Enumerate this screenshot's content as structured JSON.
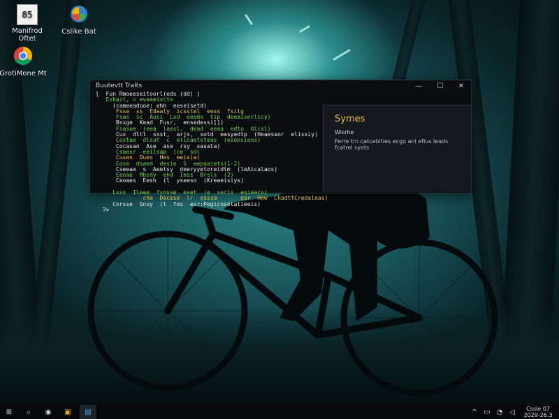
{
  "desktop": {
    "icons": [
      {
        "label": "Manifrod Oftet",
        "badge": "85"
      },
      {
        "label": "Cslike Bat"
      },
      {
        "label": "GrotiMone Mt"
      }
    ]
  },
  "terminal": {
    "title": "Buutevtt Tralts",
    "controls": {
      "minimize": "—",
      "maximize": "☐",
      "close": "✕"
    },
    "code_lines": [
      {
        "text": "ɭ  Fun Rmoeeseitoorl(eds (dd) )",
        "color": "#e8e8e8"
      },
      {
        "text": "   Ezkazt, = evaaeivcts",
        "color": "#6fd44a"
      },
      {
        "text": "     (cameeadooe; ehh  eeseisetd)",
        "color": "#e8e8e8"
      },
      {
        "text": "      Fsse  ss  Edaaly  icsstel  eess  fsilg",
        "color": "#e8c04a"
      },
      {
        "text": "      Fsas  sc  Ausi  Lxd  eeeds  tip  deeaiseclicy)",
        "color": "#6fd44a"
      },
      {
        "text": "      Bsxge  Kead  Fusr,  ensedessi[])",
        "color": "#e8e8e8"
      },
      {
        "text": "      Fsasue  (eea  laesl,  dead  eeaa  edto  dicsl)",
        "color": "#6fd44a"
      },
      {
        "text": "      Cus  dltl  ssst,  arjs,  sotd  easyedtp  (Heaesaor  elissiy)",
        "color": "#e8e8e8"
      },
      {
        "text": "      Costae  dlsut  c  elicaetsteas  (esonsieos)",
        "color": "#6fd44a"
      },
      {
        "text": "      Cocasan  Ase  ase  rsy  sasata)",
        "color": "#e8e8e8"
      },
      {
        "text": "      Csaesr  eeilsap  (ce  sd)",
        "color": "#6fd44a"
      },
      {
        "text": "      Cusen  Dues  Hes  eeis(a)",
        "color": "#e8c04a"
      },
      {
        "text": "      Eose  dsaed  desie  S  eepaaiets(1-2)",
        "color": "#6fd44a"
      },
      {
        "text": "      Cseeae  s  Aeetsy  deeryyetoreidtm  (leAicalaos)",
        "color": "#e8e8e8"
      },
      {
        "text": "      Eeoae  Mbsdy  ehd  Ieos  Brsls  (2)",
        "color": "#6fd44a"
      },
      {
        "text": "      Ceoaes  Eesh  (l  yseeso  (Kreaeisiys)",
        "color": "#e8e8e8"
      },
      {
        "text": "",
        "color": "#e8e8e8"
      },
      {
        "text": "     Lsss  Ileae  fsosse  eset  (e  seris  esieacs)",
        "color": "#6fd44a"
      },
      {
        "text": "              cha  Dacese  lr  ssssa       ear  How  ChadttCredaleas)",
        "color": "#e8c04a"
      },
      {
        "text": "     Corsse  Snuy  (l  fes  esr:Pegicosetatieeis)",
        "color": "#e8e8e8"
      },
      {
        "text": "  Ɂ>",
        "color": "#e8e8e8"
      }
    ]
  },
  "panel": {
    "title": "Symes",
    "subtitle": "Wisrhe",
    "body": "Ferre trn catcabities ecgo anl eflus leads fcatrel syots"
  },
  "taskbar": {
    "start": "⊞",
    "search": "⌕",
    "items": [
      "◉",
      "▣",
      "▤"
    ],
    "tray": [
      "^",
      "▭",
      "◔",
      "◁"
    ],
    "clock_time": "Cssle 07",
    "clock_date": "2029-26.3"
  }
}
